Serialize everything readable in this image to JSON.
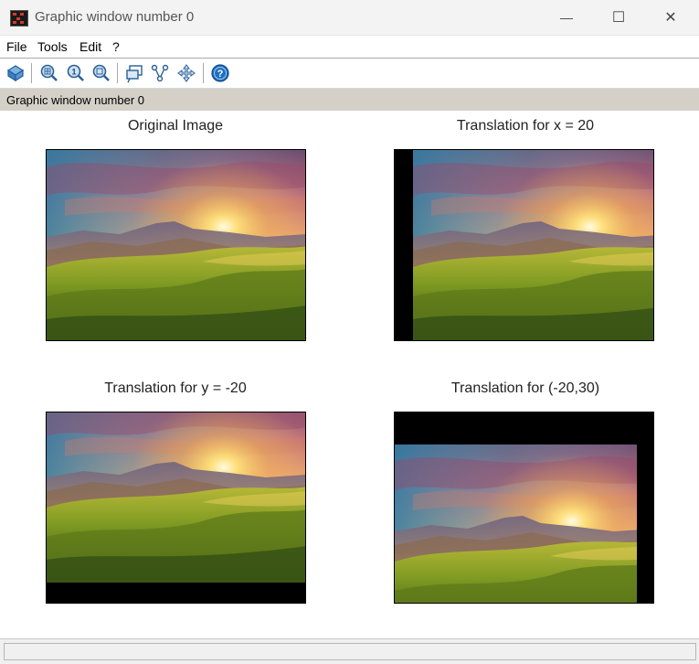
{
  "window": {
    "title": "Graphic window number 0",
    "minimize_glyph": "—",
    "maximize_glyph": "☐",
    "close_glyph": "✕"
  },
  "menu": {
    "file": "File",
    "tools": "Tools",
    "edit": "Edit",
    "help": "?"
  },
  "toolbar": {
    "icons": [
      "rotate-3d-icon",
      "zoom-area-icon",
      "zoom-reset-icon",
      "zoom-icon",
      "datatip-icon",
      "graph-edit-icon",
      "pan-icon",
      "help-icon"
    ]
  },
  "status": {
    "text": "Graphic window number 0"
  },
  "plots": [
    {
      "title": "Original Image"
    },
    {
      "title": "Translation for x = 20"
    },
    {
      "title": "Translation for y = -20"
    },
    {
      "title": "Translation for (-20,30)"
    }
  ],
  "colors": {
    "menu_border": "#a9a9a9",
    "status_bg": "#d4d0c8",
    "accent_icon": "#1e6fc0"
  }
}
